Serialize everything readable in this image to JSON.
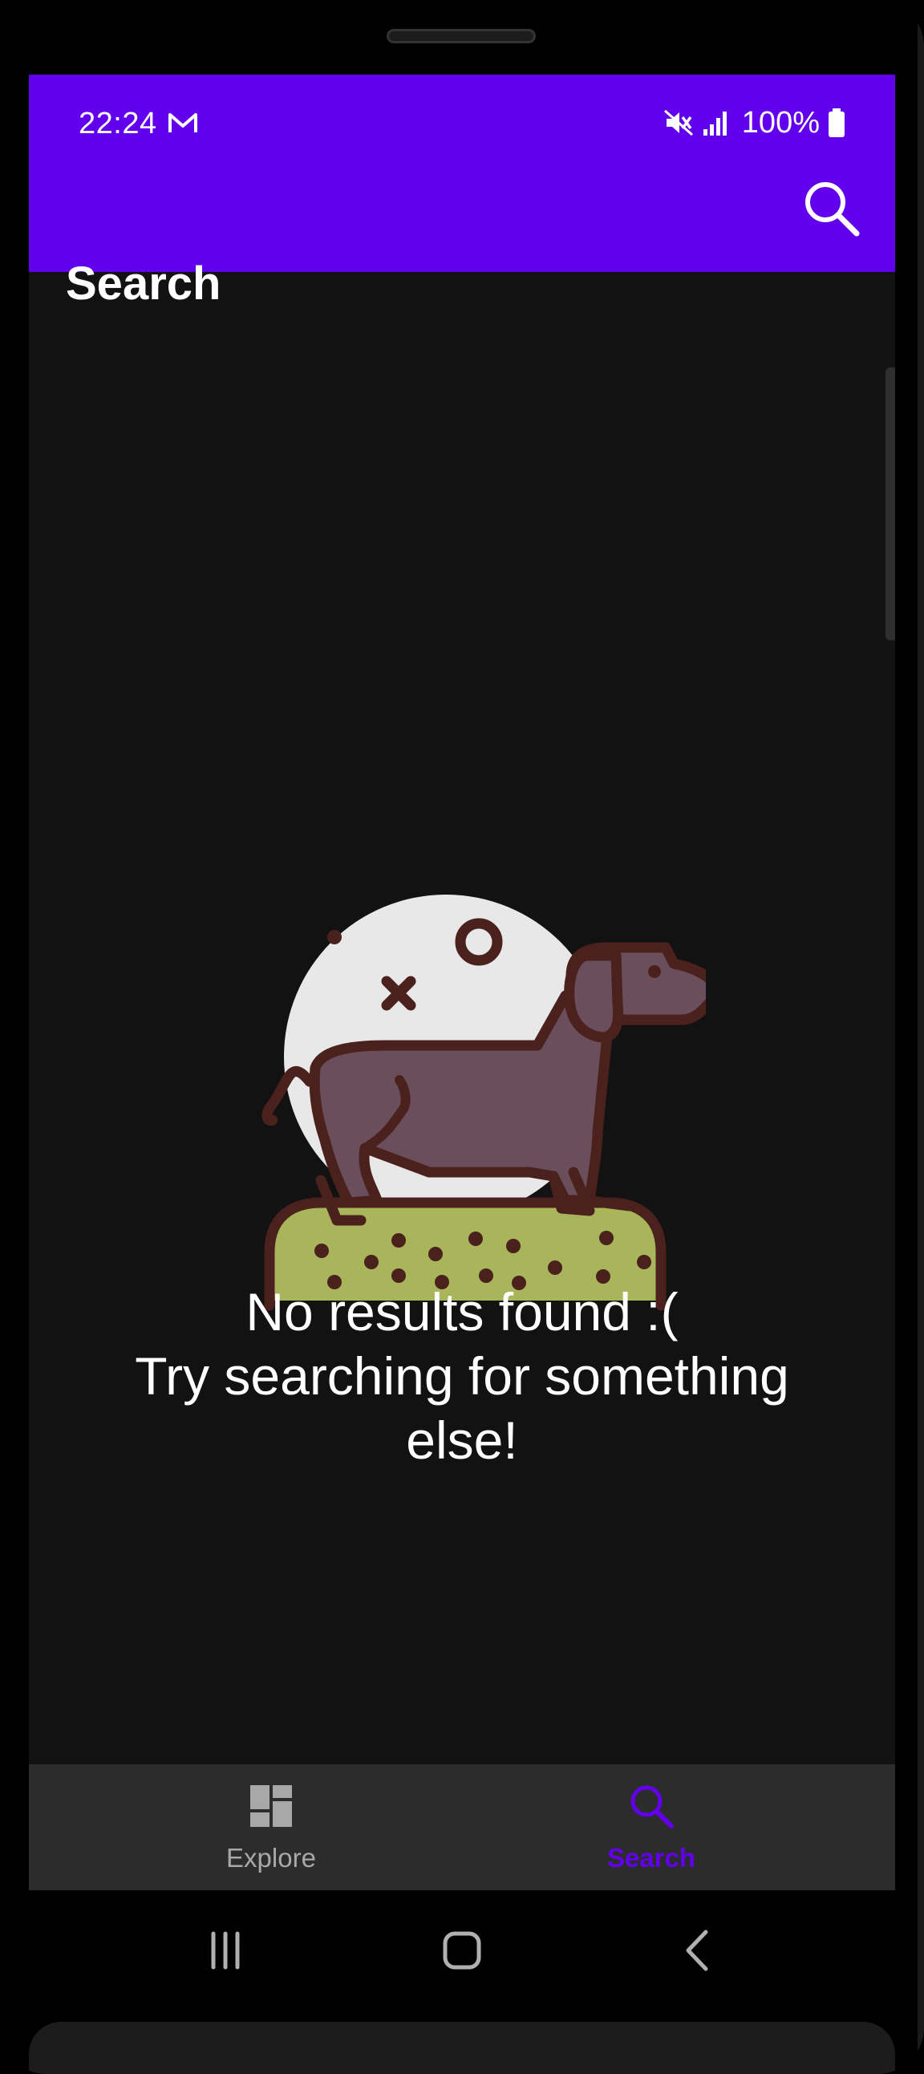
{
  "status_bar": {
    "time": "22:24",
    "notification_icon": "gmail-icon",
    "sound_icon": "mute-icon",
    "signal_icon": "signal-icon",
    "battery_percent": "100%",
    "battery_icon": "battery-full-icon"
  },
  "app_bar": {
    "title": "Search",
    "action_icon": "search-icon"
  },
  "empty_state": {
    "illustration": "dachshund-dog-illustration",
    "line1": "No results found :(",
    "line2": "Try searching for something",
    "line3": "else!"
  },
  "bottom_nav": {
    "items": [
      {
        "label": "Explore",
        "icon": "dashboard-icon",
        "selected": false
      },
      {
        "label": "Search",
        "icon": "search-icon",
        "selected": true
      }
    ]
  },
  "system_nav": {
    "recents_icon": "recents-icon",
    "home_icon": "home-icon",
    "back_icon": "back-icon"
  },
  "colors": {
    "primary": "#6200ee",
    "background": "#121212",
    "nav_background": "#2c2c2c",
    "inactive": "#a8a8a8",
    "dog_body": "#6a4e5c",
    "dog_outline": "#4a211c",
    "grass": "#a8b55a",
    "moon": "#e8e8e8"
  }
}
